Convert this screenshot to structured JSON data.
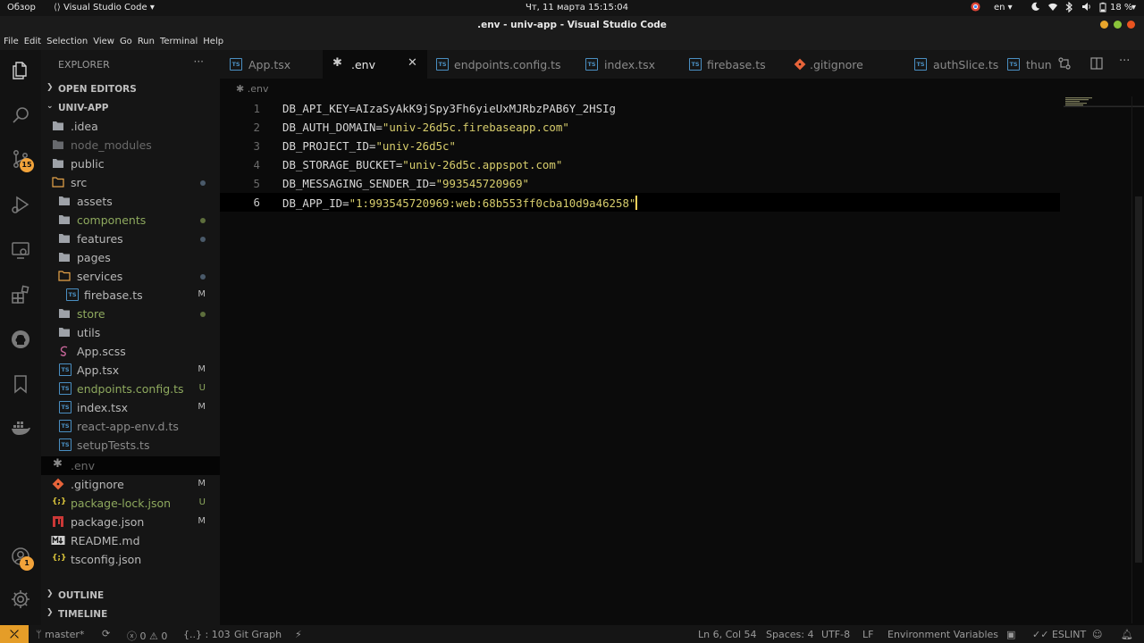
{
  "system_bar": {
    "activities": "Обзор",
    "app_menu": "Visual Studio Code",
    "clock": "Чт, 11 марта  15:15:04",
    "language": "en",
    "battery": "18 %"
  },
  "window": {
    "title": ".env - univ-app - Visual Studio Code",
    "menu": [
      "File",
      "Edit",
      "Selection",
      "View",
      "Go",
      "Run",
      "Terminal",
      "Help"
    ]
  },
  "activity_bar": {
    "scm_badge": "15",
    "accounts_badge": "1"
  },
  "explorer": {
    "title": "EXPLORER",
    "more": "···",
    "open_editors": "OPEN EDITORS",
    "project": "UNIV-APP",
    "tree": [
      {
        "name": ".idea",
        "status": ""
      },
      {
        "name": "node_modules",
        "status": ""
      },
      {
        "name": "public",
        "status": ""
      },
      {
        "name": "src",
        "status": ""
      },
      {
        "name": "assets",
        "status": ""
      },
      {
        "name": "components",
        "status": ""
      },
      {
        "name": "features",
        "status": ""
      },
      {
        "name": "pages",
        "status": ""
      },
      {
        "name": "services",
        "status": ""
      },
      {
        "name": "firebase.ts",
        "status": "M"
      },
      {
        "name": "store",
        "status": ""
      },
      {
        "name": "utils",
        "status": ""
      },
      {
        "name": "App.scss",
        "status": ""
      },
      {
        "name": "App.tsx",
        "status": "M"
      },
      {
        "name": "endpoints.config.ts",
        "status": "U"
      },
      {
        "name": "index.tsx",
        "status": "M"
      },
      {
        "name": "react-app-env.d.ts",
        "status": ""
      },
      {
        "name": "setupTests.ts",
        "status": ""
      },
      {
        "name": ".env",
        "status": ""
      },
      {
        "name": ".gitignore",
        "status": "M"
      },
      {
        "name": "package-lock.json",
        "status": "U"
      },
      {
        "name": "package.json",
        "status": "M"
      },
      {
        "name": "README.md",
        "status": ""
      },
      {
        "name": "tsconfig.json",
        "status": ""
      }
    ],
    "outline": "OUTLINE",
    "timeline": "TIMELINE"
  },
  "tabs": [
    {
      "label": "App.tsx",
      "icon": "TS"
    },
    {
      "label": ".env",
      "icon": "✱"
    },
    {
      "label": "endpoints.config.ts",
      "icon": "TS"
    },
    {
      "label": "index.tsx",
      "icon": "TS"
    },
    {
      "label": "firebase.ts",
      "icon": "TS"
    },
    {
      "label": ".gitignore",
      "icon": "git-icon"
    },
    {
      "label": "authSlice.ts",
      "icon": "TS"
    },
    {
      "label": "thun",
      "icon": "TS"
    }
  ],
  "editor": {
    "breadcrumb": ".env",
    "lines": [
      {
        "num": "1",
        "key": "DB_API_KEY=",
        "value": "AIzaSyAkK9jSpy3Fh6yieUxMJRbzPAB6Y_2HSIg"
      },
      {
        "num": "2",
        "key": "DB_AUTH_DOMAIN=",
        "value": "\"univ-26d5c.firebaseapp.com\""
      },
      {
        "num": "3",
        "key": "DB_PROJECT_ID=",
        "value": "\"univ-26d5c\""
      },
      {
        "num": "4",
        "key": "DB_STORAGE_BUCKET=",
        "value": "\"univ-26d5c.appspot.com\""
      },
      {
        "num": "5",
        "key": "DB_MESSAGING_SENDER_ID=",
        "value": "\"993545720969\""
      },
      {
        "num": "6",
        "key": "DB_APP_ID=",
        "value": "\"1:993545720969:web:68b553ff0cba10d9a46258\""
      }
    ]
  },
  "status_bar": {
    "branch": "master*",
    "errors": "0",
    "warnings": "0",
    "braces": "{..} : 103",
    "git_graph": "Git Graph",
    "position": "Ln 6, Col 54",
    "spaces": "Spaces: 4",
    "encoding": "UTF-8",
    "eol": "LF",
    "language": "Environment Variables",
    "eslint": "ESLINT"
  },
  "colors": {
    "accent_orange": "#e59d28",
    "modified_orange": "#e8a54a",
    "untracked_green": "#8ea95e",
    "string_yellow": "#d7cd6c"
  }
}
